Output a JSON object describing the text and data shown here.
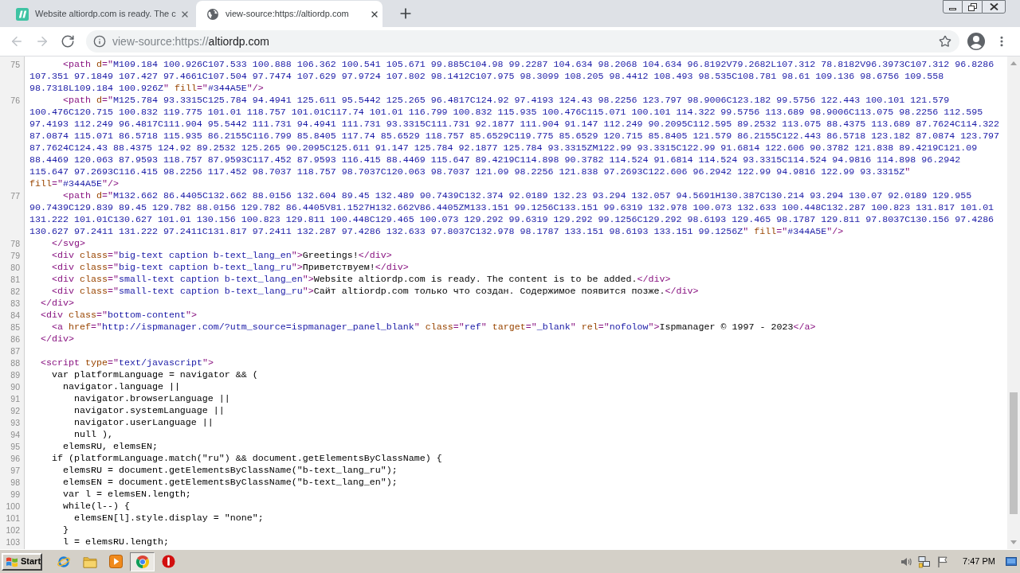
{
  "browser": {
    "tabs": [
      {
        "kind": "site",
        "title": "Website altiordp.com is ready. The c",
        "selected": false
      },
      {
        "kind": "globe",
        "title": "view-source:https://altiordp.com",
        "selected": true
      }
    ],
    "nav_buttons": [
      {
        "kind": "back",
        "disabled": true
      },
      {
        "kind": "forward",
        "disabled": true
      },
      {
        "kind": "reload",
        "disabled": false
      }
    ],
    "address": {
      "prefix": "view-source:https://",
      "host": "altiordp.com"
    }
  },
  "source": {
    "lines": [
      {
        "number": "75",
        "tokens": [
          {
            "kind": "tag",
            "text": "      <path "
          },
          {
            "kind": "attr",
            "text": "d"
          },
          {
            "kind": "tag",
            "text": "=\""
          },
          {
            "kind": "value",
            "text": "M109.184 100.926C107.533 100.888 106.362 100.541 105.671 99.885C104.98 99.2287 104.634 98.2068 104.634 96.8192V79.2682L107.312 78.8182V96.3973C107.312 96.8286 107.351 97.1849 107.427 97.4661C107.504 97.7474 107.629 97.9724 107.802 98.1412C107.975 98.3099 108.205 98.4412 108.493 98.535C108.781 98.61 109.136 98.6756 109.558 98.7318L109.184 100.926Z"
          },
          {
            "kind": "tag",
            "text": "\" "
          },
          {
            "kind": "attr",
            "text": "fill"
          },
          {
            "kind": "tag",
            "text": "=\""
          },
          {
            "kind": "value",
            "text": "#344A5E"
          },
          {
            "kind": "tag",
            "text": "\"/>"
          }
        ]
      },
      {
        "number": "76",
        "tokens": [
          {
            "kind": "tag",
            "text": "      <path "
          },
          {
            "kind": "attr",
            "text": "d"
          },
          {
            "kind": "tag",
            "text": "=\""
          },
          {
            "kind": "value",
            "text": "M125.784 93.3315C125.784 94.4941 125.611 95.5442 125.265 96.4817C124.92 97.4193 124.43 98.2256 123.797 98.9006C123.182 99.5756 122.443 100.101 121.579 100.476C120.715 100.832 119.775 101.01 118.757 101.01C117.74 101.01 116.799 100.832 115.935 100.476C115.071 100.101 114.322 99.5756 113.689 98.9006C113.075 98.2256 112.595 97.4193 112.249 96.4817C111.904 95.5442 111.731 94.4941 111.731 93.3315C111.731 92.1877 111.904 91.147 112.249 90.2095C112.595 89.2532 113.075 88.4375 113.689 87.7624C114.322 87.0874 115.071 86.5718 115.935 86.2155C116.799 85.8405 117.74 85.6529 118.757 85.6529C119.775 85.6529 120.715 85.8405 121.579 86.2155C122.443 86.5718 123.182 87.0874 123.797 87.7624C124.43 88.4375 124.92 89.2532 125.265 90.2095C125.611 91.147 125.784 92.1877 125.784 93.3315ZM122.99 93.3315C122.99 91.6814 122.606 90.3782 121.838 89.4219C121.09 88.4469 120.063 87.9593 118.757 87.9593C117.452 87.9593 116.415 88.4469 115.647 89.4219C114.898 90.3782 114.524 91.6814 114.524 93.3315C114.524 94.9816 114.898 96.2942 115.647 97.2693C116.415 98.2256 117.452 98.7037 118.757 98.7037C120.063 98.7037 121.09 98.2256 121.838 97.2693C122.606 96.2942 122.99 94.9816 122.99 93.3315Z"
          },
          {
            "kind": "tag",
            "text": "\" "
          },
          {
            "kind": "attr",
            "text": "fill"
          },
          {
            "kind": "tag",
            "text": "=\""
          },
          {
            "kind": "value",
            "text": "#344A5E"
          },
          {
            "kind": "tag",
            "text": "\"/>"
          }
        ]
      },
      {
        "number": "77",
        "tokens": [
          {
            "kind": "tag",
            "text": "      <path "
          },
          {
            "kind": "attr",
            "text": "d"
          },
          {
            "kind": "tag",
            "text": "=\""
          },
          {
            "kind": "value",
            "text": "M132.662 86.4405C132.662 88.0156 132.604 89.45 132.489 90.7439C132.374 92.0189 132.23 93.294 132.057 94.5691H130.387C130.214 93.294 130.07 92.0189 129.955 90.7439C129.839 89.45 129.782 88.0156 129.782 86.4405V81.1527H132.662V86.4405ZM133.151 99.1256C133.151 99.6319 132.978 100.073 132.633 100.448C132.287 100.823 131.817 101.01 131.222 101.01C130.627 101.01 130.156 100.823 129.811 100.448C129.465 100.073 129.292 99.6319 129.292 99.1256C129.292 98.6193 129.465 98.1787 129.811 97.8037C130.156 97.4286 130.627 97.2411 131.222 97.2411C131.817 97.2411 132.287 97.4286 132.633 97.8037C132.978 98.1787 133.151 98.6193 133.151 99.1256Z"
          },
          {
            "kind": "tag",
            "text": "\" "
          },
          {
            "kind": "attr",
            "text": "fill"
          },
          {
            "kind": "tag",
            "text": "=\""
          },
          {
            "kind": "value",
            "text": "#344A5E"
          },
          {
            "kind": "tag",
            "text": "\"/>"
          }
        ]
      },
      {
        "number": "78",
        "tokens": [
          {
            "kind": "tag",
            "text": "    </svg>"
          }
        ]
      },
      {
        "number": "79",
        "tokens": [
          {
            "kind": "tag",
            "text": "    <div "
          },
          {
            "kind": "attr",
            "text": "class"
          },
          {
            "kind": "tag",
            "text": "=\""
          },
          {
            "kind": "value",
            "text": "big-text caption b-text_lang_en"
          },
          {
            "kind": "tag",
            "text": "\">"
          },
          {
            "kind": "text",
            "text": "Greetings!"
          },
          {
            "kind": "tag",
            "text": "</div>"
          }
        ]
      },
      {
        "number": "80",
        "tokens": [
          {
            "kind": "tag",
            "text": "    <div "
          },
          {
            "kind": "attr",
            "text": "class"
          },
          {
            "kind": "tag",
            "text": "=\""
          },
          {
            "kind": "value",
            "text": "big-text caption b-text_lang_ru"
          },
          {
            "kind": "tag",
            "text": "\">"
          },
          {
            "kind": "text",
            "text": "Приветствуем!"
          },
          {
            "kind": "tag",
            "text": "</div>"
          }
        ]
      },
      {
        "number": "81",
        "tokens": [
          {
            "kind": "tag",
            "text": "    <div "
          },
          {
            "kind": "attr",
            "text": "class"
          },
          {
            "kind": "tag",
            "text": "=\""
          },
          {
            "kind": "value",
            "text": "small-text caption b-text_lang_en"
          },
          {
            "kind": "tag",
            "text": "\">"
          },
          {
            "kind": "text",
            "text": "Website altiordp.com is ready. The content is to be added."
          },
          {
            "kind": "tag",
            "text": "</div>"
          }
        ]
      },
      {
        "number": "82",
        "tokens": [
          {
            "kind": "tag",
            "text": "    <div "
          },
          {
            "kind": "attr",
            "text": "class"
          },
          {
            "kind": "tag",
            "text": "=\""
          },
          {
            "kind": "value",
            "text": "small-text caption b-text_lang_ru"
          },
          {
            "kind": "tag",
            "text": "\">"
          },
          {
            "kind": "text",
            "text": "Сайт altiordp.com только что создан. Содержимое появится позже."
          },
          {
            "kind": "tag",
            "text": "</div>"
          }
        ]
      },
      {
        "number": "83",
        "tokens": [
          {
            "kind": "tag",
            "text": "  </div>"
          }
        ]
      },
      {
        "number": "84",
        "tokens": [
          {
            "kind": "tag",
            "text": "  <div "
          },
          {
            "kind": "attr",
            "text": "class"
          },
          {
            "kind": "tag",
            "text": "=\""
          },
          {
            "kind": "value",
            "text": "bottom-content"
          },
          {
            "kind": "tag",
            "text": "\">"
          }
        ]
      },
      {
        "number": "85",
        "tokens": [
          {
            "kind": "tag",
            "text": "    <a "
          },
          {
            "kind": "attr",
            "text": "href"
          },
          {
            "kind": "tag",
            "text": "=\""
          },
          {
            "kind": "value",
            "text": "http://ispmanager.com/?utm_source=ispmanager_panel_blank"
          },
          {
            "kind": "tag",
            "text": "\" "
          },
          {
            "kind": "attr",
            "text": "class"
          },
          {
            "kind": "tag",
            "text": "=\""
          },
          {
            "kind": "value",
            "text": "ref"
          },
          {
            "kind": "tag",
            "text": "\" "
          },
          {
            "kind": "attr",
            "text": "target"
          },
          {
            "kind": "tag",
            "text": "=\""
          },
          {
            "kind": "value",
            "text": "_blank"
          },
          {
            "kind": "tag",
            "text": "\" "
          },
          {
            "kind": "attr",
            "text": "rel"
          },
          {
            "kind": "tag",
            "text": "=\""
          },
          {
            "kind": "value",
            "text": "nofolow"
          },
          {
            "kind": "tag",
            "text": "\">"
          },
          {
            "kind": "text",
            "text": "Ispmanager © 1997 - 2023"
          },
          {
            "kind": "tag",
            "text": "</a>"
          }
        ]
      },
      {
        "number": "86",
        "tokens": [
          {
            "kind": "tag",
            "text": "  </div>"
          }
        ]
      },
      {
        "number": "87"
      },
      {
        "number": "88",
        "tokens": [
          {
            "kind": "tag",
            "text": "  <script "
          },
          {
            "kind": "attr",
            "text": "type"
          },
          {
            "kind": "tag",
            "text": "=\""
          },
          {
            "kind": "value",
            "text": "text/javascript"
          },
          {
            "kind": "tag",
            "text": "\">"
          }
        ]
      },
      {
        "number": "89",
        "tokens": [
          {
            "kind": "text",
            "text": "    var platformLanguage = navigator && ("
          }
        ]
      },
      {
        "number": "90",
        "tokens": [
          {
            "kind": "text",
            "text": "      navigator.language ||"
          }
        ]
      },
      {
        "number": "91",
        "tokens": [
          {
            "kind": "text",
            "text": "        navigator.browserLanguage ||"
          }
        ]
      },
      {
        "number": "92",
        "tokens": [
          {
            "kind": "text",
            "text": "        navigator.systemLanguage ||"
          }
        ]
      },
      {
        "number": "93",
        "tokens": [
          {
            "kind": "text",
            "text": "        navigator.userLanguage ||"
          }
        ]
      },
      {
        "number": "94",
        "tokens": [
          {
            "kind": "text",
            "text": "        null ),"
          }
        ]
      },
      {
        "number": "95",
        "tokens": [
          {
            "kind": "text",
            "text": "      elemsRU, elemsEN;"
          }
        ]
      },
      {
        "number": "96",
        "tokens": [
          {
            "kind": "text",
            "text": "    if (platformLanguage.match(\"ru\") && document.getElementsByClassName) {"
          }
        ]
      },
      {
        "number": "97",
        "tokens": [
          {
            "kind": "text",
            "text": "      elemsRU = document.getElementsByClassName(\"b-text_lang_ru\");"
          }
        ]
      },
      {
        "number": "98",
        "tokens": [
          {
            "kind": "text",
            "text": "      elemsEN = document.getElementsByClassName(\"b-text_lang_en\");"
          }
        ]
      },
      {
        "number": "99",
        "tokens": [
          {
            "kind": "text",
            "text": "      var l = elemsEN.length;"
          }
        ]
      },
      {
        "number": "100",
        "tokens": [
          {
            "kind": "text",
            "text": "      while(l--) {"
          }
        ]
      },
      {
        "number": "101",
        "tokens": [
          {
            "kind": "text",
            "text": "        elemsEN[l].style.display = \"none\";"
          }
        ]
      },
      {
        "number": "102",
        "tokens": [
          {
            "kind": "text",
            "text": "      }"
          }
        ]
      },
      {
        "number": "103",
        "tokens": [
          {
            "kind": "text",
            "text": "      l = elemsRU.length;"
          }
        ]
      }
    ]
  },
  "taskbar": {
    "start": "Start",
    "apps": [
      {
        "kind": "globe-ring",
        "selected": false
      },
      {
        "kind": "folder",
        "selected": false
      },
      {
        "kind": "media",
        "selected": false
      },
      {
        "kind": "tricolor",
        "selected": true
      },
      {
        "kind": "alert",
        "selected": false
      }
    ],
    "clock": "7:47 PM"
  }
}
